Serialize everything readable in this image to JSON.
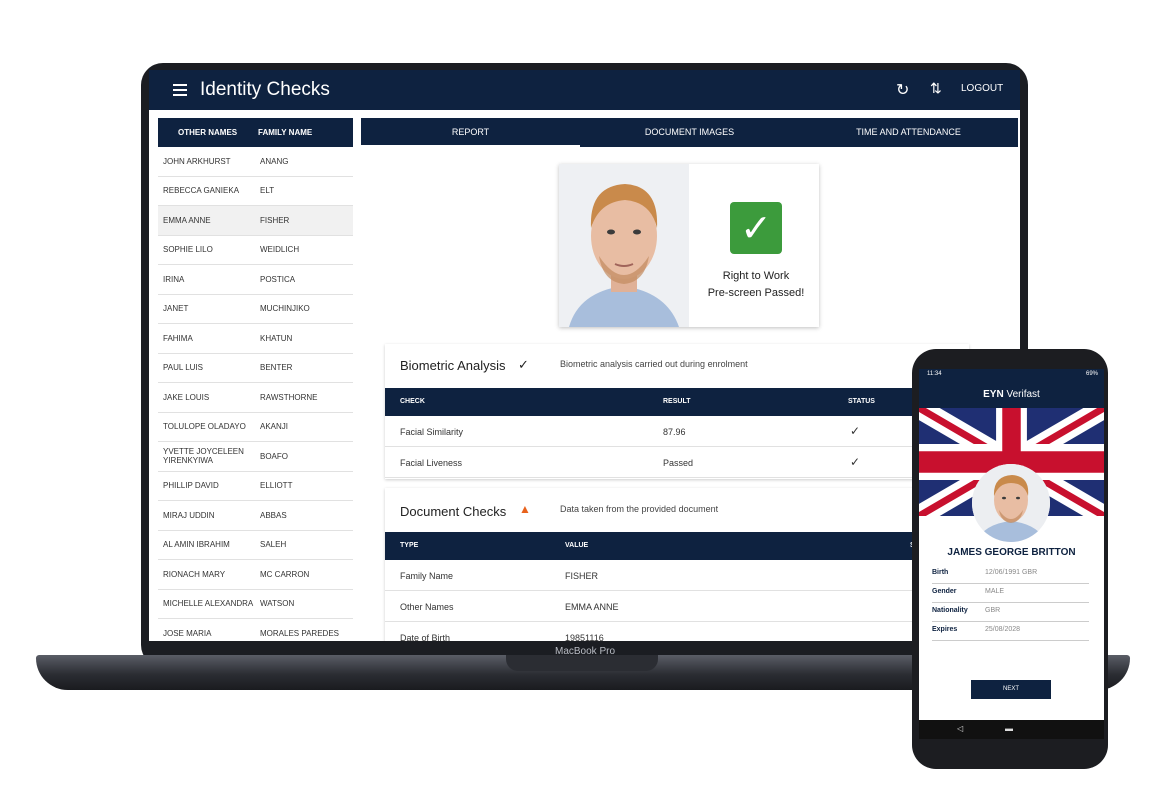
{
  "laptop": {
    "brand": "MacBook Pro",
    "app": {
      "title": "Identity Checks",
      "logout": "LOGOUT",
      "icons": {
        "menu": "hamburger-icon",
        "refresh": "refresh-icon",
        "sort": "sort-icon"
      }
    },
    "names_list": {
      "headers": [
        "OTHER NAMES",
        "FAMILY NAME"
      ],
      "selected": "EMMA ANNE FISHER",
      "rows": [
        {
          "other": "JOHN ARKHURST",
          "family": "ANANG"
        },
        {
          "other": "REBECCA GANIEKA",
          "family": "ELT"
        },
        {
          "other": "EMMA ANNE",
          "family": "FISHER"
        },
        {
          "other": "SOPHIE LILO",
          "family": "WEIDLICH"
        },
        {
          "other": "IRINA",
          "family": "POSTICA"
        },
        {
          "other": "JANET",
          "family": "MUCHINJIKO"
        },
        {
          "other": "FAHIMA",
          "family": "KHATUN"
        },
        {
          "other": "PAUL LUIS",
          "family": "BENTER"
        },
        {
          "other": "JAKE LOUIS",
          "family": "RAWSTHORNE"
        },
        {
          "other": "TOLULOPE OLADAYO",
          "family": "AKANJI"
        },
        {
          "other": "YVETTE JOYCELEEN YIRENKYIWA",
          "family": "BOAFO"
        },
        {
          "other": "PHILLIP DAVID",
          "family": "ELLIOTT"
        },
        {
          "other": "MIRAJ UDDIN",
          "family": "ABBAS"
        },
        {
          "other": "AL AMIN IBRAHIM",
          "family": "SALEH"
        },
        {
          "other": "RIONACH MARY",
          "family": "MC CARRON"
        },
        {
          "other": "MICHELLE ALEXANDRA",
          "family": "WATSON"
        },
        {
          "other": "JOSE MARIA",
          "family": "MORALES PAREDES"
        }
      ]
    },
    "tabs": [
      "REPORT",
      "DOCUMENT IMAGES",
      "TIME AND ATTENDANCE"
    ],
    "active_tab": "REPORT",
    "result": {
      "line1": "Right to Work",
      "line2": "Pre-screen Passed!",
      "accent": "#3c9b3c"
    },
    "biometric": {
      "title": "Biometric Analysis",
      "status_icon": "check-icon",
      "description": "Biometric analysis carried out during enrolment",
      "columns": [
        "CHECK",
        "RESULT",
        "STATUS"
      ],
      "rows": [
        {
          "check": "Facial Similarity",
          "result": "87.96",
          "status": "✓"
        },
        {
          "check": "Facial Liveness",
          "result": "Passed",
          "status": "✓"
        }
      ]
    },
    "document": {
      "title": "Document Checks",
      "status_icon": "warning-icon",
      "description": "Data taken from the provided document",
      "columns": [
        "TYPE",
        "VALUE",
        "S"
      ],
      "rows": [
        {
          "type": "Family Name",
          "value": "FISHER"
        },
        {
          "type": "Other Names",
          "value": "EMMA ANNE"
        },
        {
          "type": "Date of Birth",
          "value": "19851116"
        }
      ],
      "warning_color": "#e8621c"
    }
  },
  "phone": {
    "status_time": "11:34",
    "battery": "69%",
    "brand_bold": "EYN",
    "brand_rest": "Verifast",
    "name": "JAMES GEORGE BRITTON",
    "fields": [
      {
        "label": "Birth",
        "value": "12/06/1991   GBR"
      },
      {
        "label": "Gender",
        "value": "MALE"
      },
      {
        "label": "Nationality",
        "value": "GBR"
      },
      {
        "label": "Expires",
        "value": "25/08/2028"
      }
    ],
    "next_button": "NEXT",
    "nav": {
      "back": "◁",
      "home": "▬"
    }
  },
  "colors": {
    "navy": "#0e2240",
    "success": "#3c9b3c",
    "warning": "#e8621c"
  }
}
